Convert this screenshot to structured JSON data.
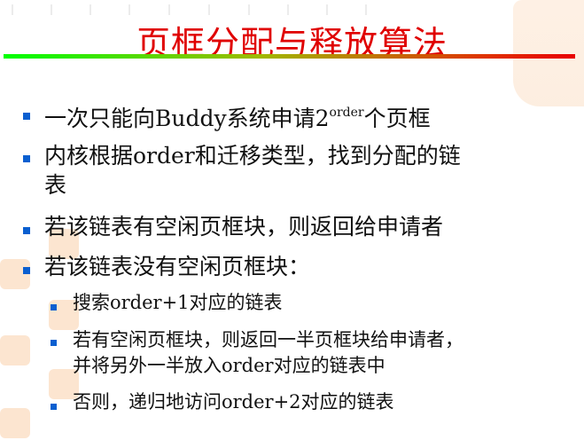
{
  "title": "页框分配与释放算法",
  "bullets": [
    {
      "pre": "一次只能向Buddy系统申请2",
      "sup": "order",
      "post": "个页框"
    },
    {
      "line1": "内核根据order和迁移类型，找到分配的链",
      "line2": "表"
    },
    {
      "text": "若该链表有空闲页框块，则返回给申请者"
    },
    {
      "text": "若该链表没有空闲页框块："
    }
  ],
  "sub_bullets": [
    {
      "text": "搜索order+1对应的链表"
    },
    {
      "line1": "若有空闲页框块，则返回一半页框块给申请者，",
      "line2": "并将另外一半放入order对应的链表中"
    },
    {
      "text": "否则，递归地访问order+2对应的链表"
    }
  ],
  "colors": {
    "title": "#e00000",
    "bullet": "#0a5fd0"
  }
}
